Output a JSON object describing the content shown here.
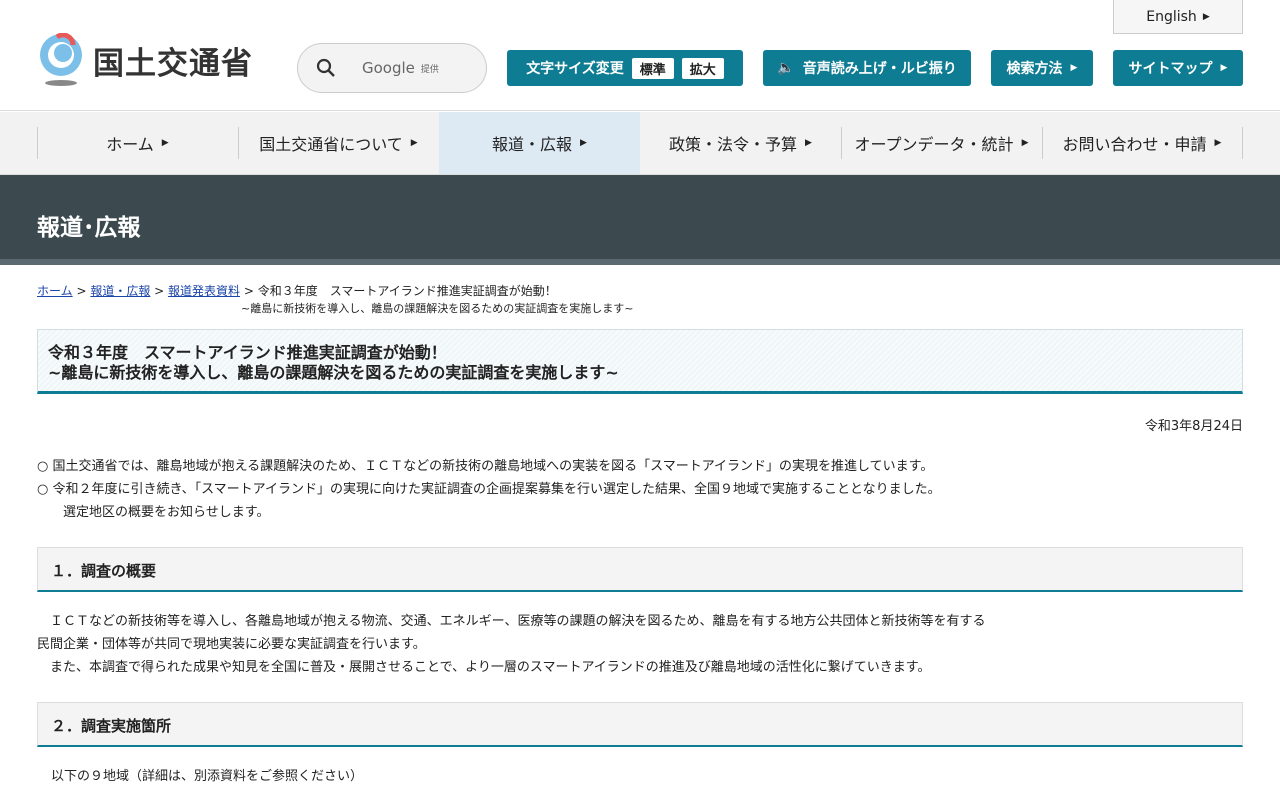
{
  "header": {
    "logo": "国土交通省",
    "search": {
      "brand": "Google",
      "provided": "提供"
    },
    "font_size": {
      "label": "文字サイズ変更",
      "standard": "標準",
      "large": "拡大"
    },
    "voice": "音声読み上げ・ルビ振り",
    "search_method": "検索方法",
    "sitemap": "サイトマップ",
    "english": "English"
  },
  "nav": [
    {
      "label": "ホーム"
    },
    {
      "label": "国土交通省について"
    },
    {
      "label": "報道・広報"
    },
    {
      "label": "政策・法令・予算"
    },
    {
      "label": "オープンデータ・統計"
    },
    {
      "label": "お問い合わせ・申請"
    }
  ],
  "banner": "報道･広報",
  "breadcrumb": {
    "home": "ホーム",
    "press": "報道・広報",
    "releases": "報道発表資料",
    "current1": "令和３年度　スマートアイランド推進実証調査が始動！",
    "current2": "~離島に新技術を導入し、離島の課題解決を図るための実証調査を実施します~"
  },
  "title": {
    "line1": "令和３年度　スマートアイランド推進実証調査が始動！",
    "line2": "~離島に新技術を導入し、離島の課題解決を図るための実証調査を実施します~"
  },
  "date": "令和3年8月24日",
  "intro": [
    "○ 国土交通省では、離島地域が抱える課題解決のため、ＩＣＴなどの新技術の離島地域への実装を図る「スマートアイランド」の実現を推進しています。",
    "○ 令和２年度に引き続き、「スマートアイランド」の実現に向けた実証調査の企画提案募集を行い選定した結果、全国９地域で実施することとなりました。",
    "　　選定地区の概要をお知らせします。"
  ],
  "section1": {
    "heading": "１．調査の概要",
    "lines": [
      "　ＩＣＴなどの新技術等を導入し、各離島地域が抱える物流、交通、エネルギー、医療等の課題の解決を図るため、離島を有する地方公共団体と新技術等を有する",
      "民間企業・団体等が共同で現地実装に必要な実証調査を行います。",
      "　また、本調査で得られた成果や知見を全国に普及・展開させることで、より一層のスマートアイランドの推進及び離島地域の活性化に繋げていきます。"
    ]
  },
  "section2": {
    "heading": "２．調査実施箇所",
    "text": "以下の９地域（詳細は、別添資料をご参照ください）"
  }
}
